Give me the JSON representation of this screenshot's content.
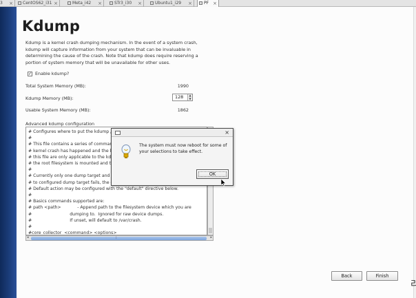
{
  "tabs": [
    {
      "label": "CentOS62_i31"
    },
    {
      "label": "Meta_i42"
    },
    {
      "label": "STr3_i30"
    },
    {
      "label": "Ubuntu1_i29"
    },
    {
      "label": "PF"
    }
  ],
  "page": {
    "title": "Kdump",
    "description": "Kdump is a kernel crash dumping mechanism. In the event of a system crash, kdump will capture information from your system that can be invaluable in determining the cause of the crash. Note that kdump does require reserving a portion of system memory that will be unavailable for other uses."
  },
  "enable": {
    "label": "Enable kdump?",
    "checked": true,
    "check_glyph": "✓"
  },
  "memory": {
    "total_label": "Total System Memory (MB):",
    "total_value": "1990",
    "kdump_label": "Kdump Memory (MB):",
    "kdump_value": "128",
    "usable_label": "Usable System Memory (MB):",
    "usable_value": "1862"
  },
  "advanced": {
    "label": "Advanced kdump configuration",
    "config_text": "# Configures where to put the kdump /\n#\n# This file contains a series of commands\n# kernel crash has happened and the k\n# this file are only applicable to the kdu\n# the root filesystem is mounted and th\n#\n# Currently only one dump target and p\n# to configured dump target fails, the d\n# Default action may be configured with the \"default\" directive below.\n#\n# Basics commands supported are:\n# path <path>            - Append path to the filesystem device which you are\n#                            dumping to.  Ignored for raw device dumps.\n#                            If unset, will default to /var/crash.\n#\n#core_collector  <command> <options>"
  },
  "dialog": {
    "close": "×",
    "message": "The system must now reboot for some of your selections to take effect.",
    "ok_label": "OK"
  },
  "nav": {
    "back_label": "Back",
    "finish_label": "Finish"
  },
  "right_edge_glyph": "리",
  "colors": {
    "sidebar": "#1b3d7a",
    "scroll_thumb": "#7ea4dc",
    "dialog_border": "#4a4a4a"
  },
  "icons": {
    "dialog": "lightbulb-icon",
    "titlebar": "window-icon",
    "cursor": "mouse-pointer-icon"
  }
}
